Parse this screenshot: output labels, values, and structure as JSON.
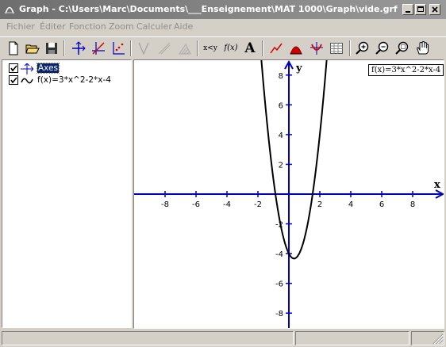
{
  "window": {
    "title": "Graph - C:\\Users\\Marc\\Documents\\___Enseignement\\MAT 1000\\Graph\\vide.grf",
    "minimize_icon": "minimize-icon",
    "maximize_icon": "maximize-icon",
    "close_icon": "close-icon"
  },
  "menu": {
    "items": [
      "Fichier",
      "Éditer",
      "Fonction",
      "Zoom",
      "Calculer",
      "Aide"
    ],
    "enabled": false
  },
  "toolbar": {
    "buttons": [
      {
        "icon": "new-file-icon"
      },
      {
        "icon": "open-folder-icon"
      },
      {
        "icon": "save-disk-icon"
      },
      {
        "icon": "axes-icon"
      },
      {
        "icon": "insert-function-icon"
      },
      {
        "icon": "insert-points-icon"
      },
      {
        "icon": "tangent-icon"
      },
      {
        "icon": "normal-icon"
      },
      {
        "icon": "shading-icon"
      },
      {
        "icon": "evaluate-icon",
        "label": "x<y"
      },
      {
        "icon": "function-icon",
        "label": "f(x)"
      },
      {
        "icon": "text-label-icon",
        "label": "A"
      },
      {
        "icon": "trendline-icon"
      },
      {
        "icon": "area-icon"
      },
      {
        "icon": "zoom-fit-icon"
      },
      {
        "icon": "table-icon"
      },
      {
        "icon": "zoom-in-icon"
      },
      {
        "icon": "zoom-out-icon"
      },
      {
        "icon": "zoom-window-icon"
      },
      {
        "icon": "pan-hand-icon"
      }
    ]
  },
  "tree": {
    "items": [
      {
        "label": "Axes",
        "checked": true,
        "selected": true,
        "icon": "axes-tree-icon"
      },
      {
        "label": "f(x)=3*x^2-2*x-4",
        "checked": true,
        "selected": false,
        "icon": "function-curve-icon"
      }
    ]
  },
  "graph": {
    "legend": "f(x)=3*x^2-2*x-4",
    "x_axis_label": "x",
    "y_axis_label": "y",
    "x_ticks": [
      "-8",
      "-6",
      "-4",
      "-2",
      "2",
      "4",
      "6",
      "8"
    ],
    "y_ticks": [
      "8",
      "6",
      "4",
      "2",
      "-2",
      "-4",
      "-6",
      "-8"
    ],
    "axis_color": "#0000c0",
    "curve_color": "#000000"
  },
  "chart_data": {
    "type": "line",
    "function": "f(x)=3*x^2-2*x-4",
    "xlim": [
      -10,
      10
    ],
    "ylim": [
      -9,
      9
    ],
    "x_ticks": [
      -8,
      -6,
      -4,
      -2,
      2,
      4,
      6,
      8
    ],
    "y_ticks": [
      8,
      6,
      4,
      2,
      -2,
      -4,
      -6,
      -8
    ],
    "grid": false,
    "series": [
      {
        "color": "#000000",
        "coefficients": [
          3,
          -2,
          -4
        ]
      }
    ]
  }
}
